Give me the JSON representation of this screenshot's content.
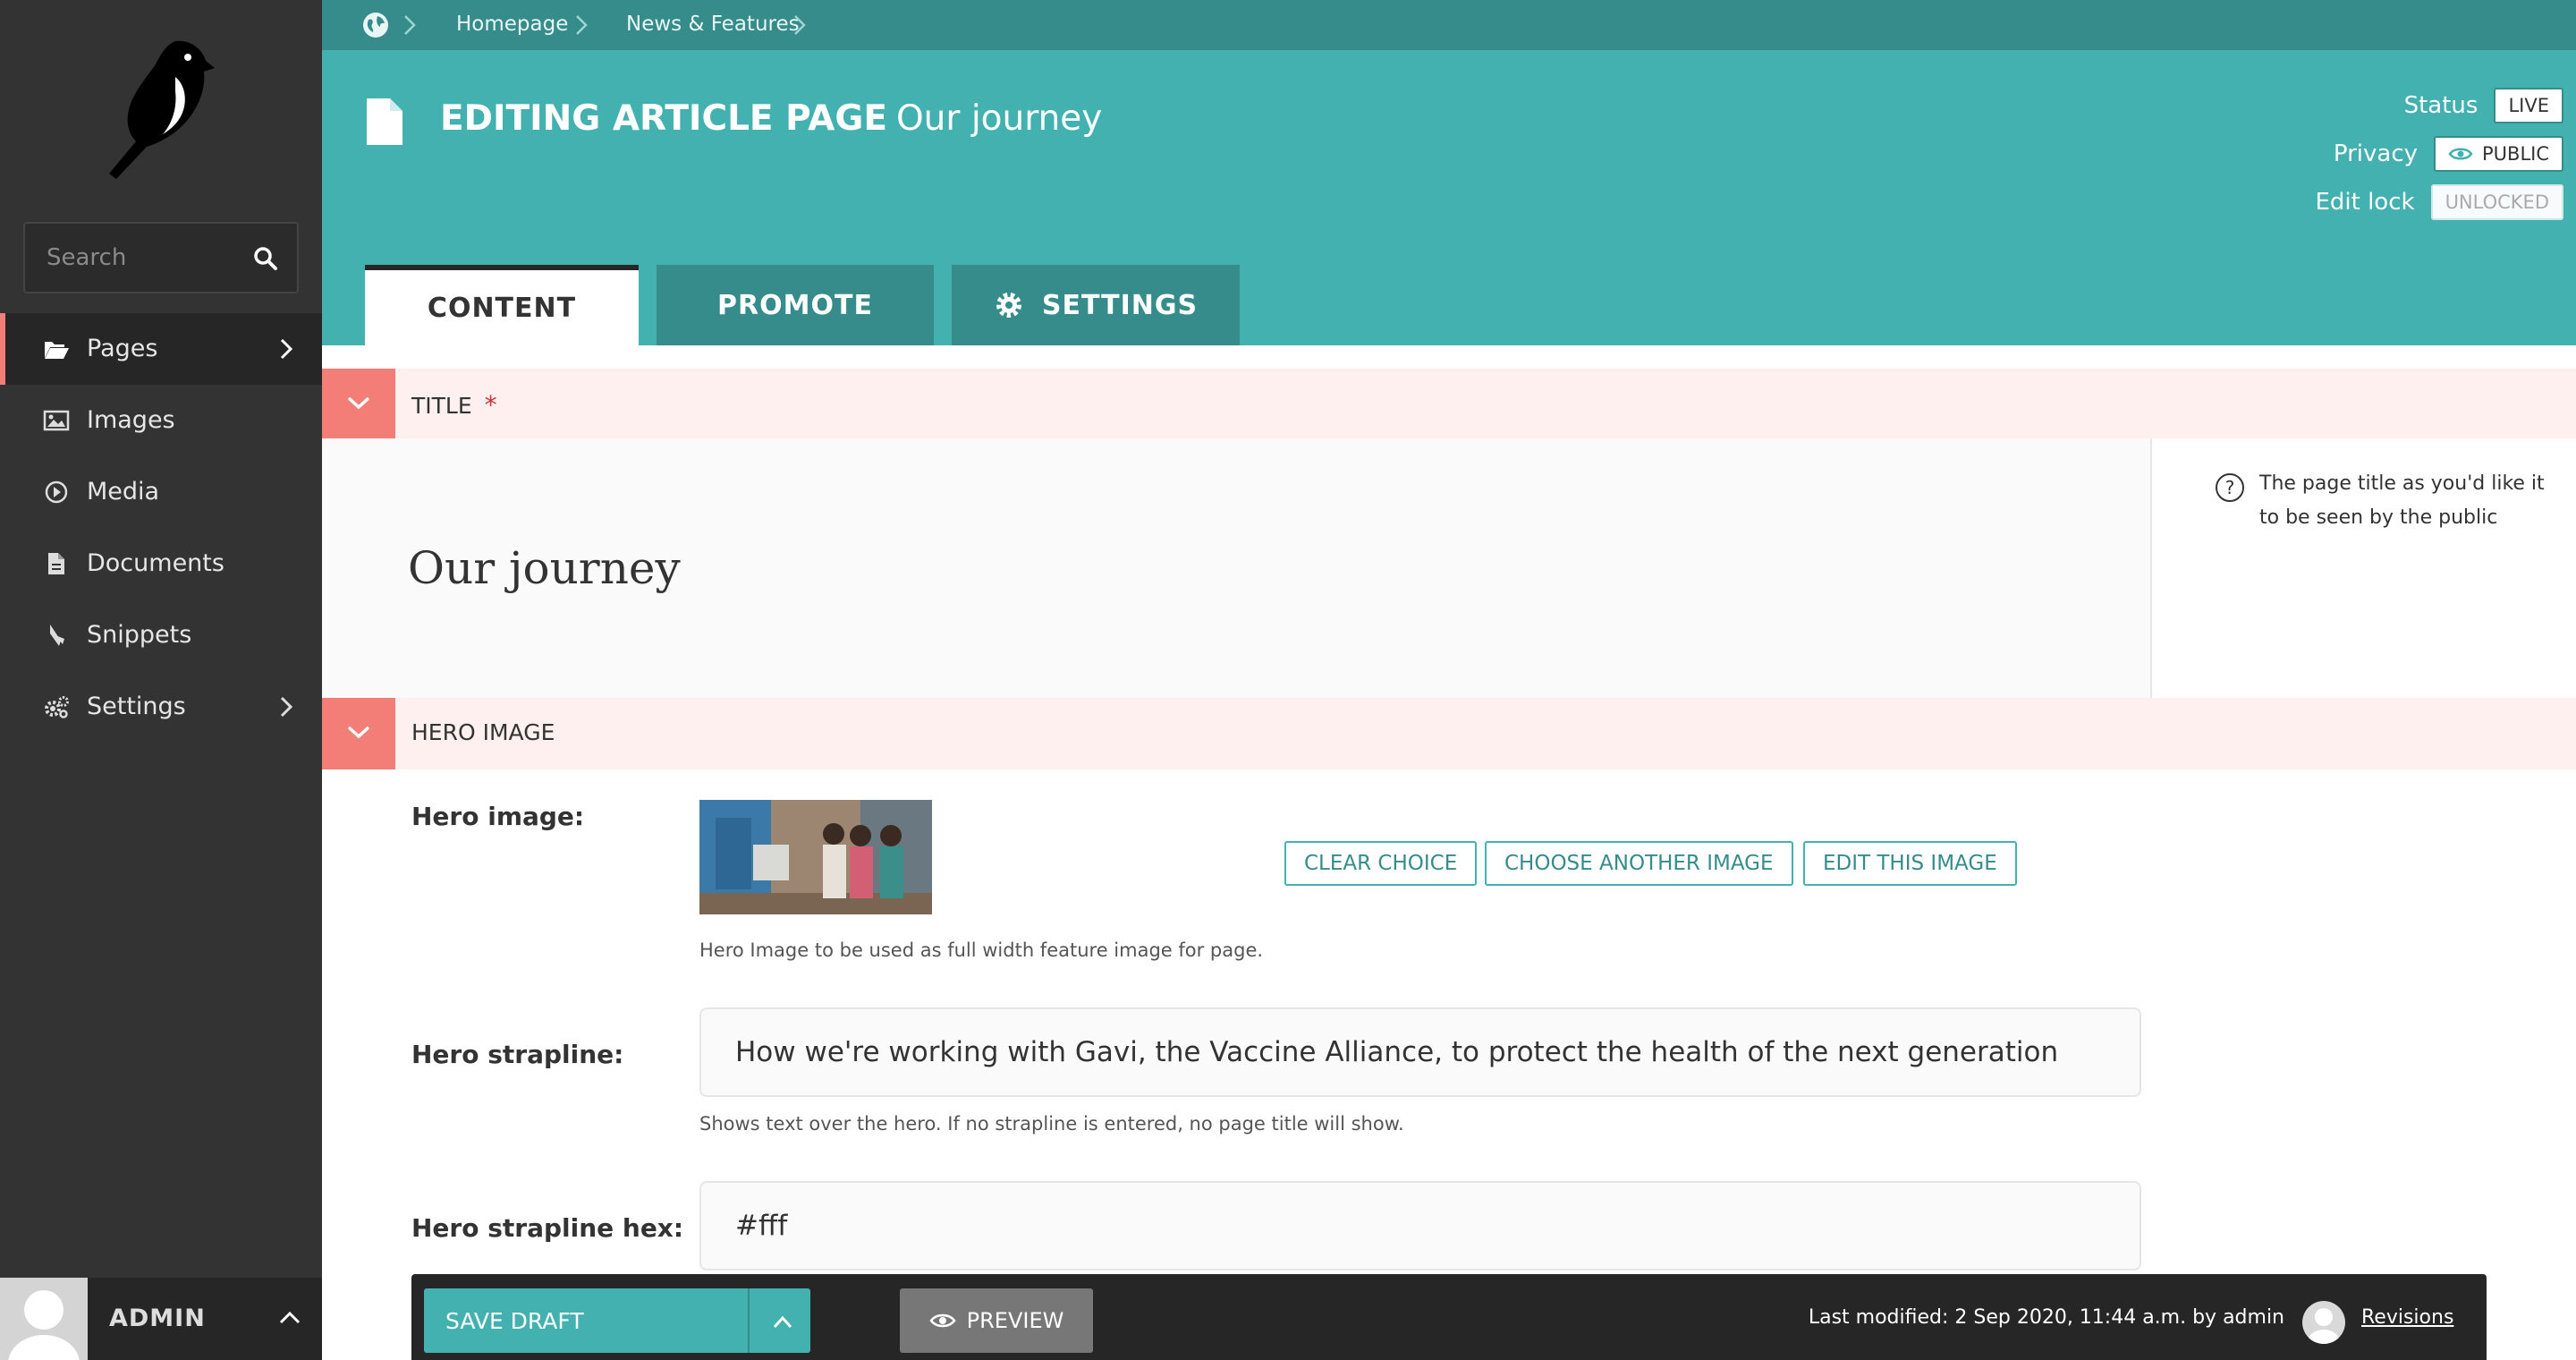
{
  "sidebar": {
    "search_placeholder": "Search",
    "items": [
      {
        "label": "Pages",
        "icon": "folder-open-icon",
        "active": true,
        "has_submenu": true
      },
      {
        "label": "Images",
        "icon": "image-icon",
        "active": false,
        "has_submenu": false
      },
      {
        "label": "Media",
        "icon": "media-play-icon",
        "active": false,
        "has_submenu": false
      },
      {
        "label": "Documents",
        "icon": "document-icon",
        "active": false,
        "has_submenu": false
      },
      {
        "label": "Snippets",
        "icon": "snippet-icon",
        "active": false,
        "has_submenu": false
      },
      {
        "label": "Settings",
        "icon": "cogs-icon",
        "active": false,
        "has_submenu": true
      }
    ],
    "account_name": "ADMIN"
  },
  "breadcrumb": {
    "items": [
      "Homepage",
      "News & Features"
    ]
  },
  "header": {
    "heading_prefix": "EDITING ARTICLE PAGE",
    "heading_title": "Our journey",
    "status_label": "Status",
    "status_value": "LIVE",
    "privacy_label": "Privacy",
    "privacy_value": "PUBLIC",
    "lock_label": "Edit lock",
    "lock_value": "UNLOCKED"
  },
  "tabs": [
    {
      "label": "CONTENT",
      "active": true
    },
    {
      "label": "PROMOTE",
      "active": false
    },
    {
      "label": "SETTINGS",
      "active": false
    }
  ],
  "sections": {
    "title": {
      "heading": "TITLE",
      "required_mark": "*",
      "value": "Our journey",
      "help": "The page title as you'd like it to be seen by the public"
    },
    "hero": {
      "heading": "HERO IMAGE",
      "image_label": "Hero image:",
      "buttons": [
        "CLEAR CHOICE",
        "CHOOSE ANOTHER IMAGE",
        "EDIT THIS IMAGE"
      ],
      "image_help": "Hero Image to be used as full width feature image for page.",
      "strapline_label": "Hero strapline:",
      "strapline_value": "How we're working with Gavi, the Vaccine Alliance, to protect the health of the next generation",
      "strapline_help": "Shows text over the hero. If no strapline is entered, no page title will show.",
      "hex_label": "Hero strapline hex:",
      "hex_value": "#fff"
    }
  },
  "footer": {
    "save_label": "SAVE DRAFT",
    "preview_label": "PREVIEW",
    "last_modified": "Last modified: 2 Sep 2020, 11:44 a.m. by admin",
    "revisions_label": "Revisions"
  },
  "colors": {
    "teal": "#43b1b0",
    "teal_dark": "#358c8b",
    "sidebar": "#333333",
    "salmon": "#f37e77",
    "section_bg": "#fdf0ef"
  }
}
